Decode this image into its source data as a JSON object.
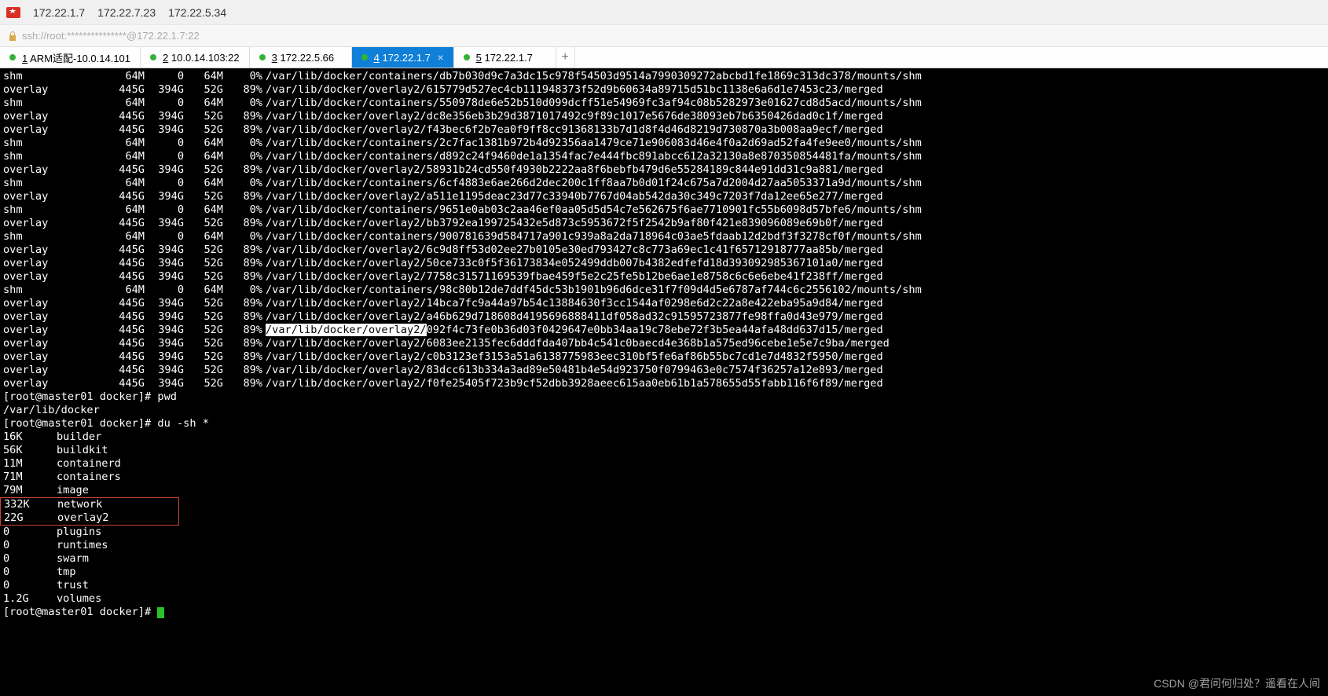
{
  "titlebar": {
    "ips": [
      "172.22.1.7",
      "172.22.7.23",
      "172.22.5.34"
    ]
  },
  "sshbar": {
    "text": "ssh://root:***************@172.22.1.7:22"
  },
  "tabs": [
    {
      "idx": "1",
      "label": "ARM适配-10.0.14.101",
      "active": false
    },
    {
      "idx": "2",
      "label": "10.0.14.103:22",
      "active": false
    },
    {
      "idx": "3",
      "label": "172.22.5.66",
      "active": false
    },
    {
      "idx": "4",
      "label": "172.22.1.7",
      "active": true
    },
    {
      "idx": "5",
      "label": "172.22.1.7",
      "active": false
    }
  ],
  "df": [
    {
      "fs": "shm",
      "size": "64M",
      "used": "0",
      "avail": "64M",
      "pct": "0%",
      "mnt": "/var/lib/docker/containers/db7b030d9c7a3dc15c978f54503d9514a7990309272abcbd1fe1869c313dc378/mounts/shm"
    },
    {
      "fs": "overlay",
      "size": "445G",
      "used": "394G",
      "avail": "52G",
      "pct": "89%",
      "mnt": "/var/lib/docker/overlay2/615779d527ec4cb111948373f52d9b60634a89715d51bc1138e6a6d1e7453c23/merged"
    },
    {
      "fs": "shm",
      "size": "64M",
      "used": "0",
      "avail": "64M",
      "pct": "0%",
      "mnt": "/var/lib/docker/containers/550978de6e52b510d099dcff51e54969fc3af94c08b5282973e01627cd8d5acd/mounts/shm"
    },
    {
      "fs": "overlay",
      "size": "445G",
      "used": "394G",
      "avail": "52G",
      "pct": "89%",
      "mnt": "/var/lib/docker/overlay2/dc8e356eb3b29d3871017492c9f89c1017e5676de38093eb7b6350426dad0c1f/merged"
    },
    {
      "fs": "overlay",
      "size": "445G",
      "used": "394G",
      "avail": "52G",
      "pct": "89%",
      "mnt": "/var/lib/docker/overlay2/f43bec6f2b7ea0f9ff8cc91368133b7d1d8f4d46d8219d730870a3b008aa9ecf/merged"
    },
    {
      "fs": "shm",
      "size": "64M",
      "used": "0",
      "avail": "64M",
      "pct": "0%",
      "mnt": "/var/lib/docker/containers/2c7fac1381b972b4d92356aa1479ce71e906083d46e4f0a2d69ad52fa4fe9ee0/mounts/shm"
    },
    {
      "fs": "shm",
      "size": "64M",
      "used": "0",
      "avail": "64M",
      "pct": "0%",
      "mnt": "/var/lib/docker/containers/d892c24f9460de1a1354fac7e444fbc891abcc612a32130a8e870350854481fa/mounts/shm"
    },
    {
      "fs": "overlay",
      "size": "445G",
      "used": "394G",
      "avail": "52G",
      "pct": "89%",
      "mnt": "/var/lib/docker/overlay2/58931b24cd550f4930b2222aa8f6bebfb479d6e55284189c844e91dd31c9a881/merged"
    },
    {
      "fs": "shm",
      "size": "64M",
      "used": "0",
      "avail": "64M",
      "pct": "0%",
      "mnt": "/var/lib/docker/containers/6cf4883e6ae266d2dec200c1ff8aa7b0d01f24c675a7d2004d27aa5053371a9d/mounts/shm"
    },
    {
      "fs": "overlay",
      "size": "445G",
      "used": "394G",
      "avail": "52G",
      "pct": "89%",
      "mnt": "/var/lib/docker/overlay2/a511e1195deac23d77c33940b7767d04ab542da30c349c7203f7da12ee65e277/merged"
    },
    {
      "fs": "shm",
      "size": "64M",
      "used": "0",
      "avail": "64M",
      "pct": "0%",
      "mnt": "/var/lib/docker/containers/9651e0ab03c2aa46ef0aa05d5d54c7e562675f6ae7710901fc55b6098d57bfe6/mounts/shm"
    },
    {
      "fs": "overlay",
      "size": "445G",
      "used": "394G",
      "avail": "52G",
      "pct": "89%",
      "mnt": "/var/lib/docker/overlay2/bb3792ea199725432e5d873c5953672f5f2542b9af80f421e839096089e69b0f/merged"
    },
    {
      "fs": "shm",
      "size": "64M",
      "used": "0",
      "avail": "64M",
      "pct": "0%",
      "mnt": "/var/lib/docker/containers/900781639d584717a901c939a8a2da718964c03ae5fdaab12d2bdf3f3278cf0f/mounts/shm"
    },
    {
      "fs": "overlay",
      "size": "445G",
      "used": "394G",
      "avail": "52G",
      "pct": "89%",
      "mnt": "/var/lib/docker/overlay2/6c9d8ff53d02ee27b0105e30ed793427c8c773a69ec1c41f65712918777aa85b/merged"
    },
    {
      "fs": "overlay",
      "size": "445G",
      "used": "394G",
      "avail": "52G",
      "pct": "89%",
      "mnt": "/var/lib/docker/overlay2/50ce733c0f5f36173834e052499ddb007b4382edfefd18d393092985367101a0/merged"
    },
    {
      "fs": "overlay",
      "size": "445G",
      "used": "394G",
      "avail": "52G",
      "pct": "89%",
      "mnt": "/var/lib/docker/overlay2/7758c31571169539fbae459f5e2c25fe5b12be6ae1e8758c6c6e6ebe41f238ff/merged"
    },
    {
      "fs": "shm",
      "size": "64M",
      "used": "0",
      "avail": "64M",
      "pct": "0%",
      "mnt": "/var/lib/docker/containers/98c80b12de7ddf45dc53b1901b96d6dce31f7f09d4d5e6787af744c6c2556102/mounts/shm"
    },
    {
      "fs": "overlay",
      "size": "445G",
      "used": "394G",
      "avail": "52G",
      "pct": "89%",
      "mnt": "/var/lib/docker/overlay2/14bca7fc9a44a97b54c13884630f3cc1544af0298e6d2c22a8e422eba95a9d84/merged"
    },
    {
      "fs": "overlay",
      "size": "445G",
      "used": "394G",
      "avail": "52G",
      "pct": "89%",
      "mnt": "/var/lib/docker/overlay2/a46b629d718608d4195696888411df058ad32c91595723877fe98ffa0d43e979/merged"
    },
    {
      "fs": "overlay",
      "size": "445G",
      "used": "394G",
      "avail": "52G",
      "pct": "89%",
      "mnt_hl": "/var/lib/docker/overlay2/",
      "mnt_rest": "092f4c73fe0b36d03f0429647e0bb34aa19c78ebe72f3b5ea44afa48dd637d15/merged"
    },
    {
      "fs": "overlay",
      "size": "445G",
      "used": "394G",
      "avail": "52G",
      "pct": "89%",
      "mnt": "/var/lib/docker/overlay2/6083ee2135fec6dddfda407bb4c541c0baecd4e368b1a575ed96cebe1e5e7c9ba/merged"
    },
    {
      "fs": "overlay",
      "size": "445G",
      "used": "394G",
      "avail": "52G",
      "pct": "89%",
      "mnt": "/var/lib/docker/overlay2/c0b3123ef3153a51a6138775983eec310bf5fe6af86b55bc7cd1e7d4832f5950/merged"
    },
    {
      "fs": "overlay",
      "size": "445G",
      "used": "394G",
      "avail": "52G",
      "pct": "89%",
      "mnt": "/var/lib/docker/overlay2/83dcc613b334a3ad89e50481b4e54d923750f0799463e0c7574f36257a12e893/merged"
    },
    {
      "fs": "overlay",
      "size": "445G",
      "used": "394G",
      "avail": "52G",
      "pct": "89%",
      "mnt": "/var/lib/docker/overlay2/f0fe25405f723b9cf52dbb3928aeec615aa0eb61b1a578655d55fabb116f6f89/merged"
    }
  ],
  "prompt1": {
    "prefix": "[root@master01 docker]# ",
    "cmd": "pwd"
  },
  "pwd_output": "/var/lib/docker",
  "prompt2": {
    "prefix": "[root@master01 docker]# ",
    "cmd": "du -sh *"
  },
  "du": [
    {
      "size": "16K",
      "name": "builder"
    },
    {
      "size": "56K",
      "name": "buildkit"
    },
    {
      "size": "11M",
      "name": "containerd"
    },
    {
      "size": "71M",
      "name": "containers"
    },
    {
      "size": "79M",
      "name": "image"
    },
    {
      "size": "332K",
      "name": "network"
    },
    {
      "size": "22G",
      "name": "overlay2"
    },
    {
      "size": "0",
      "name": "plugins"
    },
    {
      "size": "0",
      "name": "runtimes"
    },
    {
      "size": "0",
      "name": "swarm"
    },
    {
      "size": "0",
      "name": "tmp"
    },
    {
      "size": "0",
      "name": "trust"
    },
    {
      "size": "1.2G",
      "name": "volumes"
    }
  ],
  "prompt3": {
    "prefix": "[root@master01 docker]# "
  },
  "watermark": "CSDN @君问何归处？遥看在人间"
}
